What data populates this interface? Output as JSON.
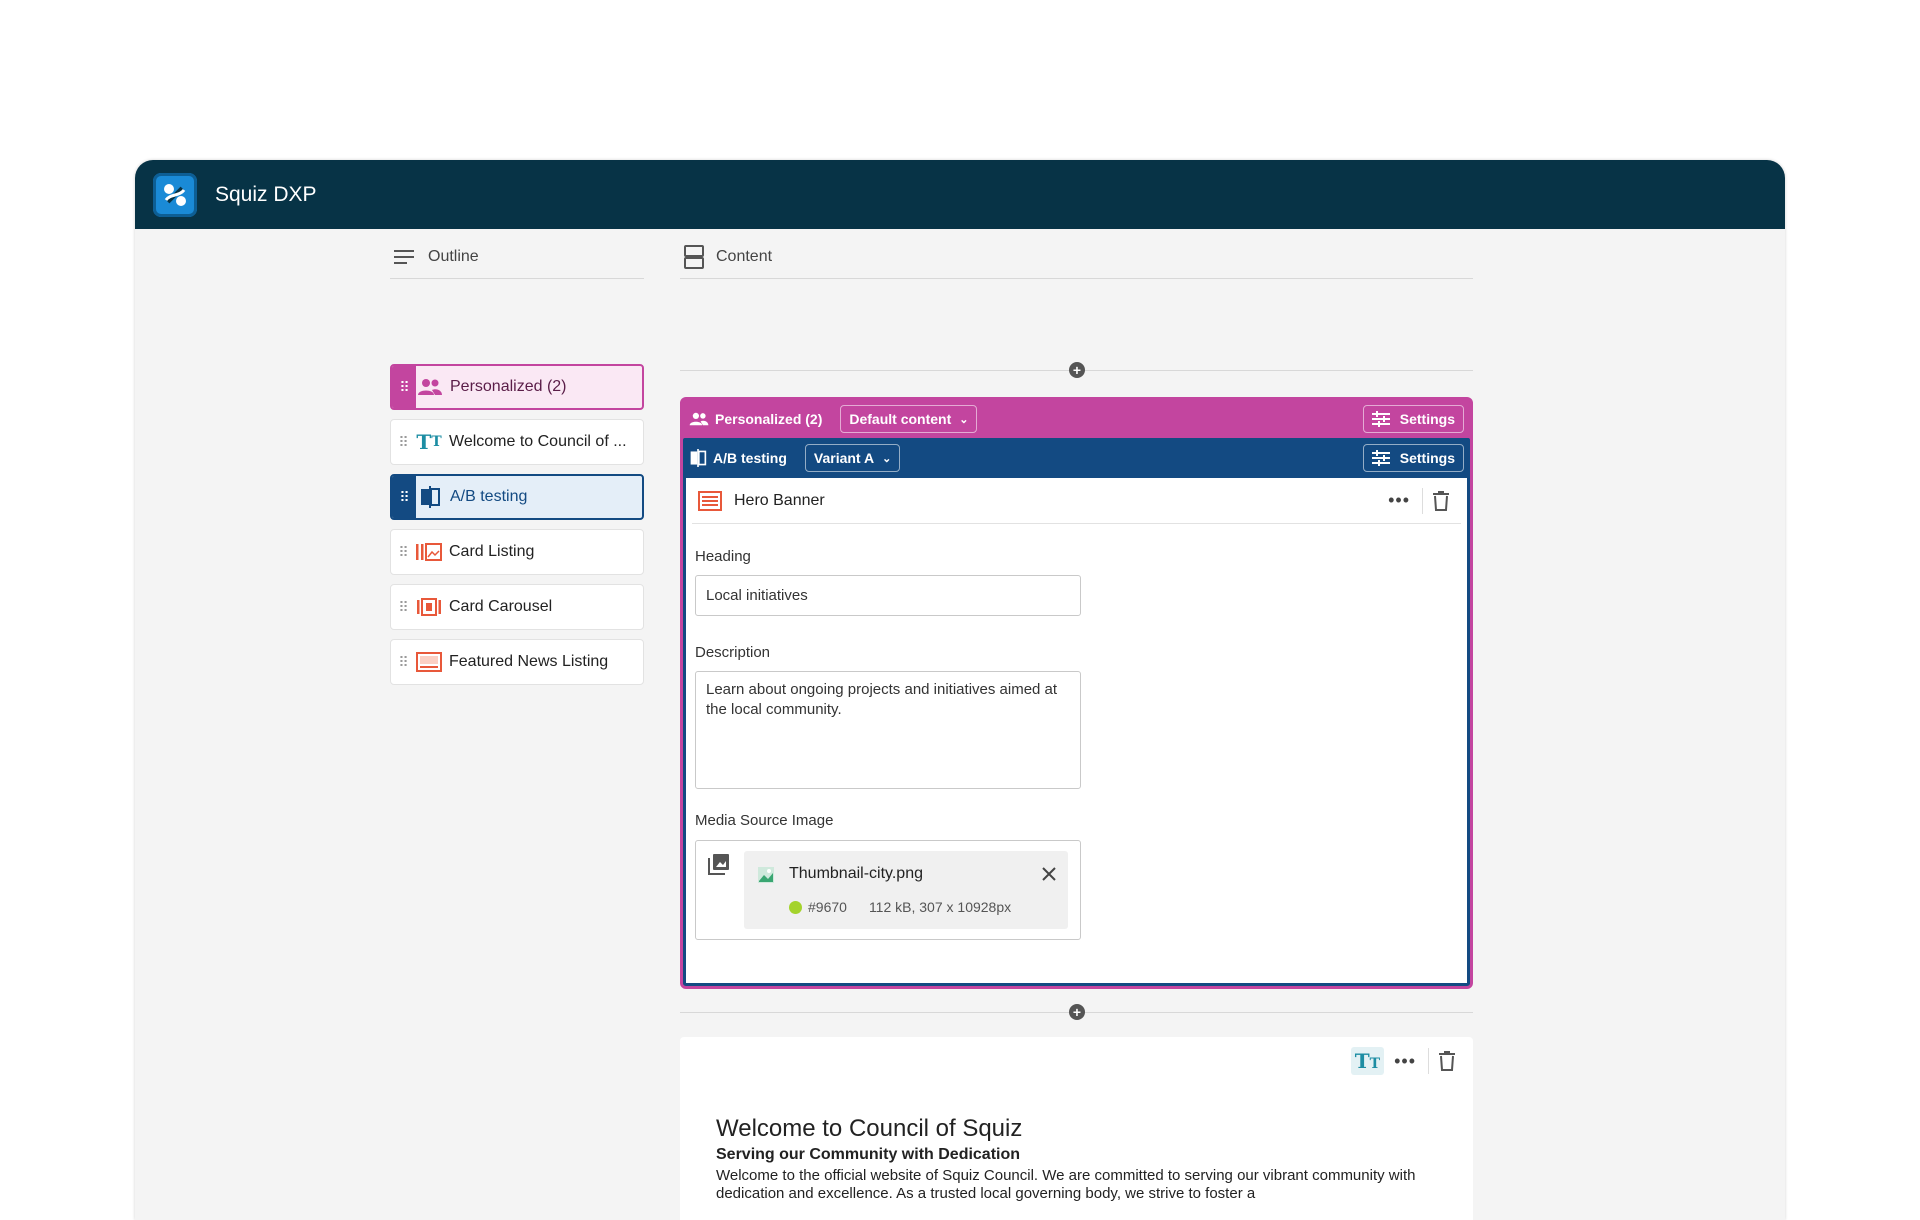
{
  "app": {
    "title": "Squiz DXP"
  },
  "outline": {
    "heading": "Outline",
    "items": [
      {
        "label": "Personalized (2)"
      },
      {
        "label": "Welcome to Council of ..."
      },
      {
        "label": "A/B testing"
      },
      {
        "label": "Card Listing"
      },
      {
        "label": "Card Carousel"
      },
      {
        "label": "Featured News Listing"
      }
    ]
  },
  "content": {
    "heading": "Content",
    "personalized": {
      "label": "Personalized (2)",
      "dropdown": "Default content",
      "settings": "Settings"
    },
    "ab": {
      "label": "A/B testing",
      "dropdown": "Variant A",
      "settings": "Settings"
    },
    "hero": {
      "title": "Hero Banner",
      "heading_label": "Heading",
      "heading_value": "Local initiatives",
      "description_label": "Description",
      "description_value": "Learn about ongoing projects and initiatives aimed at the local community.",
      "media_label": "Media Source Image",
      "media": {
        "filename": "Thumbnail-city.png",
        "id": "#9670",
        "meta": "112 kB, 307 x 10928px"
      }
    },
    "text_component": {
      "title": "Welcome to Council of Squiz",
      "subtitle": "Serving our Community with Dedication",
      "body": "Welcome to the official website of Squiz Council. We are committed to serving our vibrant community with dedication and excellence. As a trusted local governing body, we strive to foster a"
    }
  },
  "colors": {
    "topbar": "#073346",
    "personalized": "#c3459f",
    "ab": "#134a82",
    "accent": "#e8583a"
  }
}
